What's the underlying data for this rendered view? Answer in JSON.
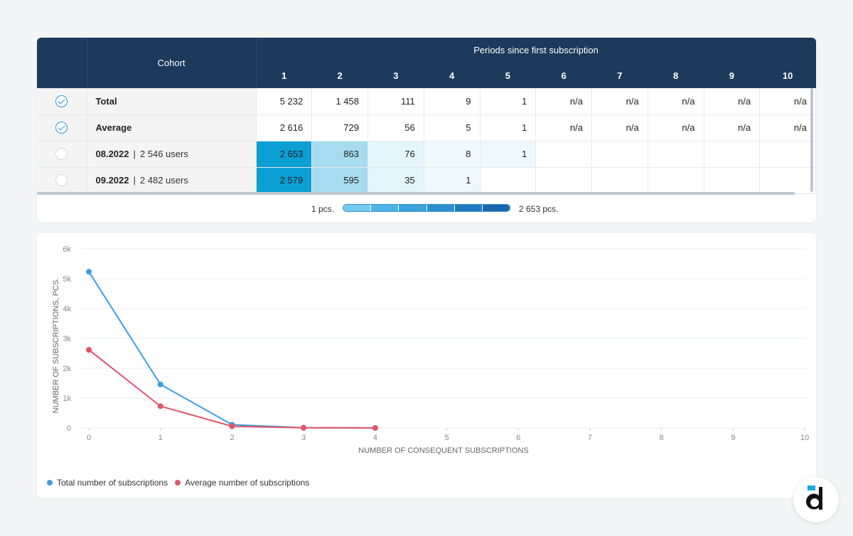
{
  "table": {
    "cohort_header": "Cohort",
    "periods_header": "Periods since first subscription",
    "periods": [
      "1",
      "2",
      "3",
      "4",
      "5",
      "6",
      "7",
      "8",
      "9",
      "10"
    ],
    "rows": [
      {
        "checked": true,
        "label": "Total",
        "users": "",
        "values": [
          "5 232",
          "1 458",
          "111",
          "9",
          "1",
          "n/a",
          "n/a",
          "n/a",
          "n/a",
          "n/a"
        ]
      },
      {
        "checked": true,
        "label": "Average",
        "users": "",
        "values": [
          "2 616",
          "729",
          "56",
          "5",
          "1",
          "n/a",
          "n/a",
          "n/a",
          "n/a",
          "n/a"
        ]
      },
      {
        "checked": false,
        "label": "08.2022",
        "users": "2 546 users",
        "values": [
          "2 653",
          "863",
          "76",
          "8",
          "1",
          "",
          "",
          "",
          "",
          ""
        ]
      },
      {
        "checked": false,
        "label": "09.2022",
        "users": "2 482 users",
        "values": [
          "2 579",
          "595",
          "35",
          "1",
          "",
          "",
          "",
          "",
          "",
          ""
        ]
      }
    ],
    "heat_colors": {
      "2 653": "#0b9fd3",
      "2 579": "#0b9fd3",
      "863": "#a7dcf0",
      "595": "#a7dcf0",
      "76": "#e4f5fb",
      "35": "#e4f5fb",
      "8": "#eef9fd",
      "1": "#eef9fd"
    },
    "scale": {
      "min_label": "1 pcs.",
      "max_label": "2 653 pcs.",
      "colors": [
        "#74c9ef",
        "#4db4e6",
        "#3aa3dc",
        "#2b8fcf",
        "#1e79bf",
        "#1668ae"
      ]
    }
  },
  "chart_data": {
    "type": "line",
    "x": [
      0,
      1,
      2,
      3,
      4,
      5,
      6,
      7,
      8,
      9,
      10
    ],
    "xlabel": "NUMBER OF CONSEQUENT SUBSCRIPTIONS",
    "ylabel": "NUMBER OF SUBSCRIPTIONS, PCS.",
    "ylim": [
      0,
      6000
    ],
    "yticks": [
      0,
      1000,
      2000,
      3000,
      4000,
      5000,
      6000
    ],
    "ytick_labels": [
      "0",
      "1k",
      "2k",
      "3k",
      "4k",
      "5k",
      "6k"
    ],
    "xtick_labels": [
      "0",
      "1",
      "2",
      "3",
      "4",
      "5",
      "6",
      "7",
      "8",
      "9",
      "10"
    ],
    "grid": true,
    "legend_position": "bottom-left",
    "series": [
      {
        "name": "Total number of subscriptions",
        "color": "#3d9fe0",
        "points": [
          [
            0,
            5232
          ],
          [
            1,
            1458
          ],
          [
            2,
            111
          ],
          [
            3,
            9
          ],
          [
            4,
            1
          ]
        ]
      },
      {
        "name": "Average number of subscriptions",
        "color": "#e2536a",
        "points": [
          [
            0,
            2616
          ],
          [
            1,
            729
          ],
          [
            2,
            56
          ],
          [
            3,
            5
          ],
          [
            4,
            1
          ]
        ]
      }
    ]
  }
}
